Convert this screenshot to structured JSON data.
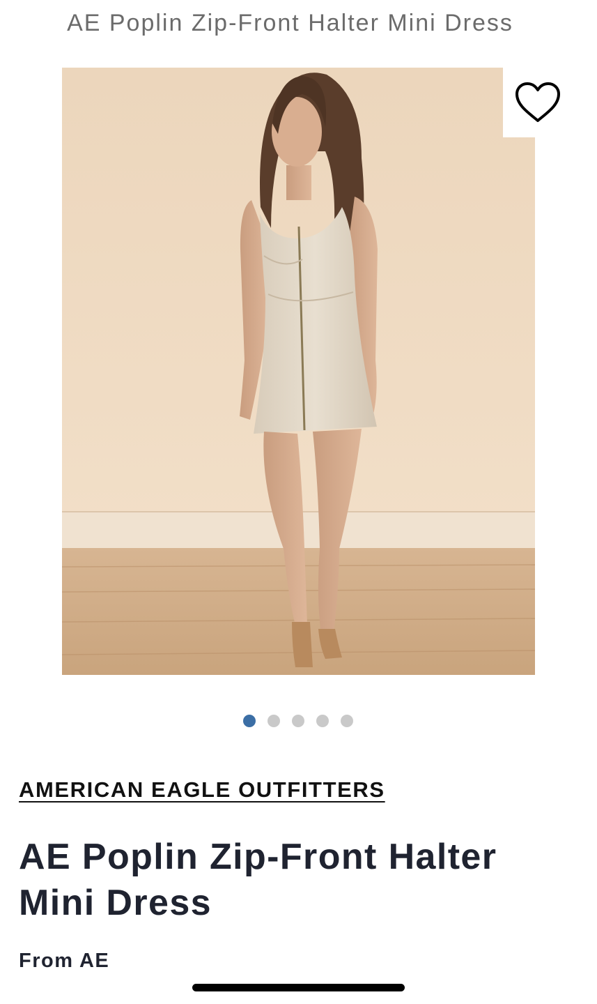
{
  "header": {
    "title": "AE Poplin Zip-Front Halter Mini Dress"
  },
  "gallery": {
    "image_alt": "Model wearing beige zip-front halter mini dress",
    "favorite_icon": "heart-outline-icon",
    "dot_count": 5,
    "active_index": 0,
    "active_color": "#3b6ea5",
    "inactive_color": "#c9c9c9"
  },
  "product": {
    "brand": "AMERICAN EAGLE OUTFITTERS",
    "name": "AE Poplin Zip-Front Halter Mini Dress",
    "from_label": "From AE"
  }
}
